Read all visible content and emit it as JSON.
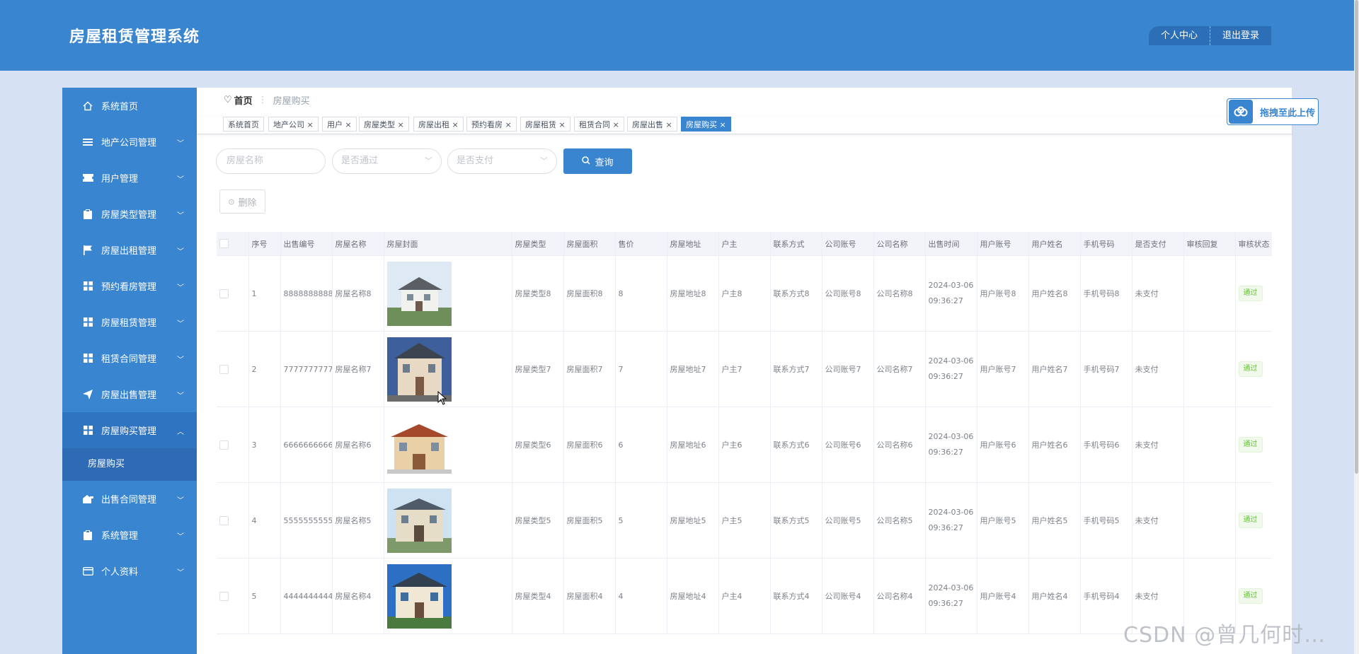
{
  "app": {
    "title": "房屋租赁管理系统"
  },
  "header": {
    "personal_center": "个人中心",
    "logout": "退出登录"
  },
  "sidebar": {
    "items": [
      {
        "label": "系统首页",
        "icon": "home-icon",
        "expandable": false
      },
      {
        "label": "地产公司管理",
        "icon": "list-icon",
        "expandable": true
      },
      {
        "label": "用户管理",
        "icon": "ticket-icon",
        "expandable": true
      },
      {
        "label": "房屋类型管理",
        "icon": "clipboard-icon",
        "expandable": true
      },
      {
        "label": "房屋出租管理",
        "icon": "flag-icon",
        "expandable": true
      },
      {
        "label": "预约看房管理",
        "icon": "grid-icon",
        "expandable": true
      },
      {
        "label": "房屋租赁管理",
        "icon": "grid-icon",
        "expandable": true
      },
      {
        "label": "租赁合同管理",
        "icon": "grid-icon",
        "expandable": true
      },
      {
        "label": "房屋出售管理",
        "icon": "send-icon",
        "expandable": true
      },
      {
        "label": "房屋购买管理",
        "icon": "grid-icon",
        "expandable": true,
        "open": true
      },
      {
        "label": "出售合同管理",
        "icon": "home-cart-icon",
        "expandable": true
      },
      {
        "label": "系统管理",
        "icon": "clipboard-icon",
        "expandable": true
      },
      {
        "label": "个人资料",
        "icon": "card-icon",
        "expandable": true
      }
    ],
    "submenu": {
      "label": "房屋购买"
    }
  },
  "breadcrumb": {
    "home": "首页",
    "current": "房屋购买"
  },
  "tags": [
    "系统首页",
    "地产公司",
    "用户",
    "房屋类型",
    "房屋出租",
    "预约看房",
    "房屋租赁",
    "租赁合同",
    "房屋出售",
    "房屋购买"
  ],
  "upload": {
    "label": "拖拽至此上传"
  },
  "search": {
    "name_placeholder": "房屋名称",
    "approved_placeholder": "是否通过",
    "paid_placeholder": "是否支付",
    "button": "查询"
  },
  "actions": {
    "delete": "删除"
  },
  "table": {
    "columns": [
      "序号",
      "出售编号",
      "房屋名称",
      "房屋封面",
      "房屋类型",
      "房屋面积",
      "售价",
      "房屋地址",
      "户主",
      "联系方式",
      "公司账号",
      "公司名称",
      "出售时间",
      "用户账号",
      "用户姓名",
      "手机号码",
      "是否支付",
      "审核回复",
      "审核状态"
    ],
    "rows": [
      {
        "idx": "1",
        "sale_no": "8888888888",
        "name": "房屋名称8",
        "type": "房屋类型8",
        "area": "房屋面积8",
        "price": "8",
        "address": "房屋地址8",
        "owner": "户主8",
        "contact": "联系方式8",
        "company_account": "公司账号8",
        "company_name": "公司名称8",
        "date": "2024-03-06",
        "time": "09:36:27",
        "user_account": "用户账号8",
        "user_name": "用户姓名8",
        "phone": "手机号码8",
        "paid": "未支付",
        "reply": "",
        "status": "通过"
      },
      {
        "idx": "2",
        "sale_no": "7777777777",
        "name": "房屋名称7",
        "type": "房屋类型7",
        "area": "房屋面积7",
        "price": "7",
        "address": "房屋地址7",
        "owner": "户主7",
        "contact": "联系方式7",
        "company_account": "公司账号7",
        "company_name": "公司名称7",
        "date": "2024-03-06",
        "time": "09:36:27",
        "user_account": "用户账号7",
        "user_name": "用户姓名7",
        "phone": "手机号码7",
        "paid": "未支付",
        "reply": "",
        "status": "通过"
      },
      {
        "idx": "3",
        "sale_no": "6666666666",
        "name": "房屋名称6",
        "type": "房屋类型6",
        "area": "房屋面积6",
        "price": "6",
        "address": "房屋地址6",
        "owner": "户主6",
        "contact": "联系方式6",
        "company_account": "公司账号6",
        "company_name": "公司名称6",
        "date": "2024-03-06",
        "time": "09:36:27",
        "user_account": "用户账号6",
        "user_name": "用户姓名6",
        "phone": "手机号码6",
        "paid": "未支付",
        "reply": "",
        "status": "通过"
      },
      {
        "idx": "4",
        "sale_no": "5555555555",
        "name": "房屋名称5",
        "type": "房屋类型5",
        "area": "房屋面积5",
        "price": "5",
        "address": "房屋地址5",
        "owner": "户主5",
        "contact": "联系方式5",
        "company_account": "公司账号5",
        "company_name": "公司名称5",
        "date": "2024-03-06",
        "time": "09:36:27",
        "user_account": "用户账号5",
        "user_name": "用户姓名5",
        "phone": "手机号码5",
        "paid": "未支付",
        "reply": "",
        "status": "通过"
      },
      {
        "idx": "5",
        "sale_no": "4444444444",
        "name": "房屋名称4",
        "type": "房屋类型4",
        "area": "房屋面积4",
        "price": "4",
        "address": "房屋地址4",
        "owner": "户主4",
        "contact": "联系方式4",
        "company_account": "公司账号4",
        "company_name": "公司名称4",
        "date": "2024-03-06",
        "time": "09:36:27",
        "user_account": "用户账号4",
        "user_name": "用户姓名4",
        "phone": "手机号码4",
        "paid": "未支付",
        "reply": "",
        "status": "通过"
      }
    ]
  },
  "watermark": "CSDN @曾几何时…",
  "colors": {
    "primary": "#3a85cf",
    "page_bg": "#d6e2f3",
    "success": "#67c23a"
  }
}
